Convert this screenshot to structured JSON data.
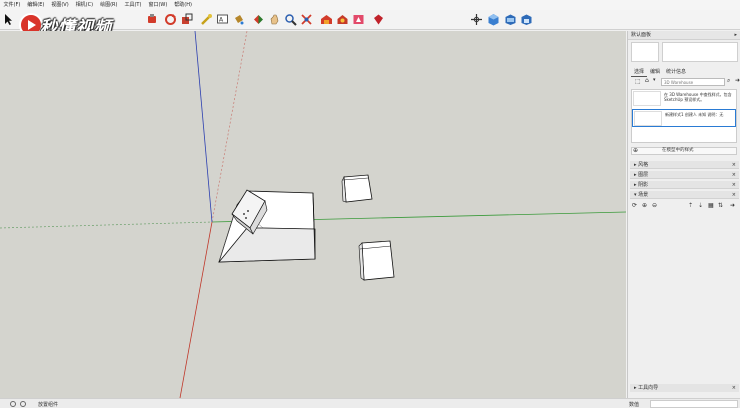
{
  "window": {
    "title_brand": "秒懂视频"
  },
  "menu": [
    {
      "label": "文件(F)"
    },
    {
      "label": "编辑(E)"
    },
    {
      "label": "视图(V)"
    },
    {
      "label": "相机(C)"
    },
    {
      "label": "绘图(R)"
    },
    {
      "label": "工具(T)"
    },
    {
      "label": "窗口(W)"
    },
    {
      "label": "帮助(H)"
    }
  ],
  "toolbar": {
    "icons": [
      "select-icon",
      "eraser-icon",
      "paint-icon",
      "move-icon",
      "rotate-icon",
      "scale-icon",
      "tape-icon",
      "text-icon",
      "axes-icon",
      "orbit-icon",
      "pan-icon",
      "zoom-icon",
      "zoom-extents-icon",
      "warehouse-icon",
      "extension-icon",
      "ruby-icon",
      "section-icon",
      "iso-view-icon",
      "top-view-icon",
      "front-view-icon"
    ]
  },
  "panel": {
    "title": "默认面板",
    "tabs": [
      {
        "label": "选择"
      },
      {
        "label": "编辑"
      },
      {
        "label": "统计信息"
      }
    ],
    "search_placeholder": "3D Warehouse",
    "styles": [
      {
        "text": "在 3D Warehouse 中查找样式，包含 SketchUp 预设样式。"
      },
      {
        "text": "新建样式1 创建人 未知 说明：无"
      }
    ],
    "style_field_label": "在模型中的样式",
    "trays": [
      {
        "label": "风格"
      },
      {
        "label": "图层"
      },
      {
        "label": "阴影"
      },
      {
        "label": "场景"
      }
    ],
    "bottom_tray": "工具向导"
  },
  "status": {
    "hint": "放置组件",
    "measure_label": "数值"
  },
  "colors": {
    "viewport_bg": "#d4d4ce",
    "axis_green": "#3a9a3a",
    "axis_red": "#c0392b",
    "axis_blue": "#2c3fb0",
    "selection": "#2a7bd4"
  }
}
